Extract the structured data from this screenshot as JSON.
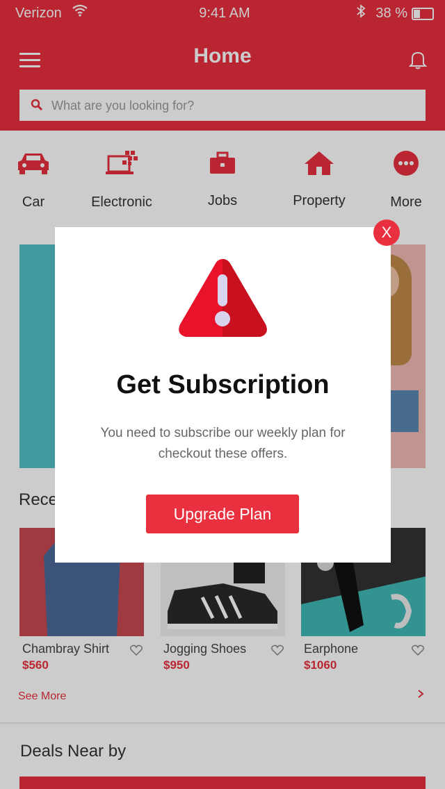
{
  "status_bar": {
    "carrier": "Verizon",
    "time": "9:41 AM",
    "battery": "38 %"
  },
  "header": {
    "title": "Home"
  },
  "search": {
    "placeholder": "What are you looking for?"
  },
  "categories": [
    {
      "label": "Car",
      "icon": "car-icon"
    },
    {
      "label": "Electronic",
      "icon": "electronic-icon"
    },
    {
      "label": "Jobs",
      "icon": "briefcase-icon"
    },
    {
      "label": "Property",
      "icon": "house-icon"
    },
    {
      "label": "More",
      "icon": "more-icon"
    }
  ],
  "recent": {
    "title": "Rece",
    "products": [
      {
        "name": "Chambray Shirt",
        "price": "$560"
      },
      {
        "name": "Jogging Shoes",
        "price": "$950"
      },
      {
        "name": "Earphone",
        "price": "$1060"
      }
    ],
    "see_more": "See More"
  },
  "deals": {
    "title": "Deals Near by"
  },
  "modal": {
    "close_label": "X",
    "title": "Get Subscription",
    "text": "You need to subscribe our weekly plan for checkout these offers.",
    "button": "Upgrade Plan"
  },
  "colors": {
    "accent": "#e8303f",
    "banner": "#53bfc7"
  }
}
